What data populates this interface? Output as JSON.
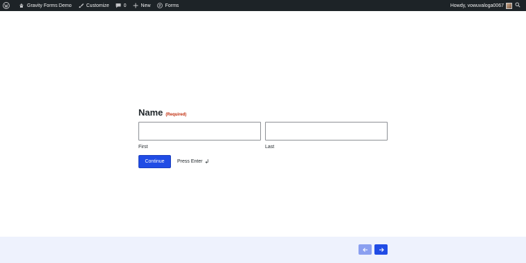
{
  "admin_bar": {
    "site_name": "Gravity Forms Demo",
    "customize": "Customize",
    "comments_count": "0",
    "new": "New",
    "forms": "Forms",
    "howdy": "Howdy, vowuvaloga0067"
  },
  "form": {
    "field_label": "Name",
    "required_label": "(Required)",
    "first_label": "First",
    "last_label": "Last",
    "first_value": "",
    "last_value": "",
    "continue_label": "Continue",
    "press_enter": "Press Enter"
  },
  "colors": {
    "admin_bar_bg": "#1d2327",
    "primary": "#204ce5",
    "required": "#c02b0a",
    "footer_bg": "#eef2fd"
  },
  "icons": {
    "wp_logo": "wordpress-icon",
    "site": "home-icon",
    "customize": "brush-icon",
    "comments": "comment-icon",
    "new": "plus-icon",
    "forms": "gravity-forms-icon",
    "search": "search-icon",
    "enter": "return-icon",
    "prev": "arrow-left-icon",
    "next": "arrow-right-icon"
  }
}
